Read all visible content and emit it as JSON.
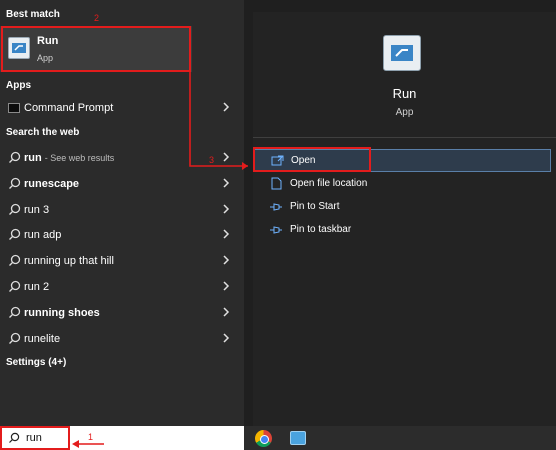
{
  "best_match": {
    "title": "Best match",
    "app_name": "Run",
    "app_type": "App",
    "icon": "run-app-icon"
  },
  "apps": {
    "title": "Apps",
    "items": [
      {
        "label": "Command Prompt",
        "icon": "command-prompt-icon"
      }
    ]
  },
  "search_web": {
    "title": "Search the web",
    "items": [
      {
        "label": "run",
        "hint": "- See web results"
      },
      {
        "label": "runescape"
      },
      {
        "label": "run 3"
      },
      {
        "label": "run adp"
      },
      {
        "label": "running up that hill"
      },
      {
        "label": "run 2"
      },
      {
        "label": "running shoes"
      },
      {
        "label": "runelite"
      }
    ]
  },
  "settings": {
    "title": "Settings (4+)"
  },
  "details": {
    "name": "Run",
    "type": "App",
    "actions": [
      {
        "label": "Open",
        "icon": "open-icon"
      },
      {
        "label": "Open file location",
        "icon": "file-location-icon"
      },
      {
        "label": "Pin to Start",
        "icon": "pin-icon"
      },
      {
        "label": "Pin to taskbar",
        "icon": "pin-icon"
      }
    ]
  },
  "search_box": {
    "value": "run"
  },
  "taskbar": {
    "apps": [
      "chrome-icon",
      "run-app-icon"
    ]
  },
  "annotations": {
    "step1": "1",
    "step2": "2",
    "step3": "3",
    "color": "#e31c1c"
  },
  "colors": {
    "accent": "#5a7fa8",
    "annotation": "#e31c1c"
  }
}
